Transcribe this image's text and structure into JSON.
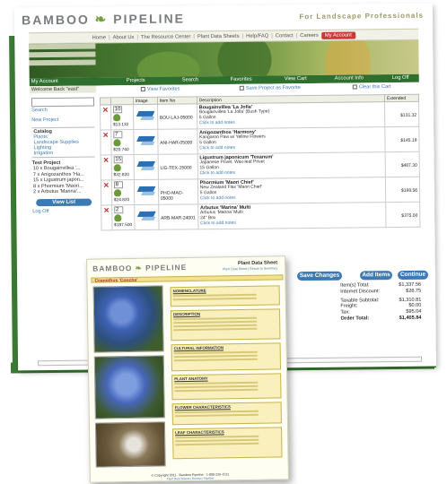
{
  "brand": {
    "logo_left": "BAMBOO",
    "logo_right": "PIPELINE",
    "tagline": "For Landscape Professionals"
  },
  "topnav": {
    "items": [
      "Home",
      "About Us",
      "The Resource Center",
      "Plant Data Sheets",
      "Help/FAQ",
      "Contact",
      "Careers"
    ],
    "account": "My Account"
  },
  "subnav": {
    "items": [
      "Projects",
      "Search",
      "Favorites",
      "View Cart",
      "Account Info",
      "Log Off"
    ]
  },
  "left": {
    "header": "My Account",
    "welcome": "Welcome Back \"east\"",
    "search": "Search",
    "new_project": "New Project",
    "catalog_head": "Catalog",
    "catalog_items": [
      "Plants",
      "Landscape Supplies",
      "Lighting",
      "Irrigation"
    ],
    "test_project_head": "Test Project",
    "test_project_lines": [
      "10 x Bougainvillea '...",
      "7 x Anigozanthos 'Ha...",
      "15 x Ligustrum japon...",
      "8 x Phormium 'Maori...",
      "2 x Arbutus 'Marina'..."
    ],
    "view_list": "View List",
    "log_off": "Log Off"
  },
  "cart": {
    "view_favorites": "View Favorites",
    "save_project": "Save Project as Favorite",
    "clear_cart": "Clear this Cart",
    "headers": [
      "Image",
      "Item No",
      "Description",
      "Extended"
    ],
    "rows": [
      {
        "qty": "10",
        "price": "$13.132",
        "item": "BOU-LAJ-05000",
        "name": "Bougainvillea 'La Jolla'",
        "sub1": "Bougainvillea 'La Jolla' (Bush Type)",
        "sub2": "5 Gallon",
        "note": "Click to add notes",
        "ext": "$131.32"
      },
      {
        "qty": "7",
        "price": "$20.740",
        "item": "ANI-HAR-05000",
        "name": "Anigozanthos 'Harmony'",
        "sub1": "Kangaroo Paw w/ Yellow Flowers",
        "sub2": "5 Gallon",
        "note": "Click to add notes",
        "ext": "$145.18"
      },
      {
        "qty": "15",
        "price": "$32.820",
        "item": "LIG-TEX-15000",
        "name": "Ligustrum japonicum 'Texanum'",
        "sub1": "Japanese Privet, Wax-leaf Privet",
        "sub2": "15 Gallon",
        "note": "Click to add notes",
        "ext": "$487.30"
      },
      {
        "qty": "8",
        "price": "$24.820",
        "item": "PHO-MAO-05000",
        "name": "Phormium 'Maori Chief'",
        "sub1": "New Zealand Flax 'Maori Chief'",
        "sub2": "5 Gallon",
        "note": "Click to add notes",
        "ext": "$198.56"
      },
      {
        "qty": "2",
        "price": "$187.500",
        "item": "ARB-MAR-24001",
        "name": "Arbutus 'Marina' Multi",
        "sub1": "Arbutus 'Marina' Multi",
        "sub2": "24\" Box",
        "note": "Click to add notes",
        "ext": "$375.00"
      }
    ],
    "save_changes": "Save Changes",
    "add_items": "Add Items",
    "continue": "Continue",
    "totals": [
      {
        "label": "Item(s) Total:",
        "value": "$1,337.56"
      },
      {
        "label": "Internet Discount:",
        "value": "$26.75"
      },
      {
        "label": "Taxable Subtotal:",
        "value": "$1,310.81"
      },
      {
        "label": "Freight:",
        "value": "$0.00"
      },
      {
        "label": "Tax:",
        "value": "$95.04"
      },
      {
        "label": "Order Total:",
        "value": "$1,405.84"
      }
    ]
  },
  "sheet": {
    "logo_left": "BAMBOO",
    "logo_right": "PIPELINE",
    "title": "Plant Data Sheet",
    "subtitle": "Plant Data Sheet | Return to Summary",
    "plant": "Ceanothus 'Concha'",
    "sections": [
      "NOMENCLATURE",
      "DESCRIPTION",
      "CULTURAL INFORMATION",
      "PLANT ANATOMY",
      "FLOWER CHARACTERISTICS",
      "LEAF CHARACTERISTICS"
    ],
    "footer": "© Copyright 2011 · Bamboo Pipeline · 1-888-226-1511",
    "footer_links": "Plant Data Sheets | Bamboo Pipeline"
  }
}
